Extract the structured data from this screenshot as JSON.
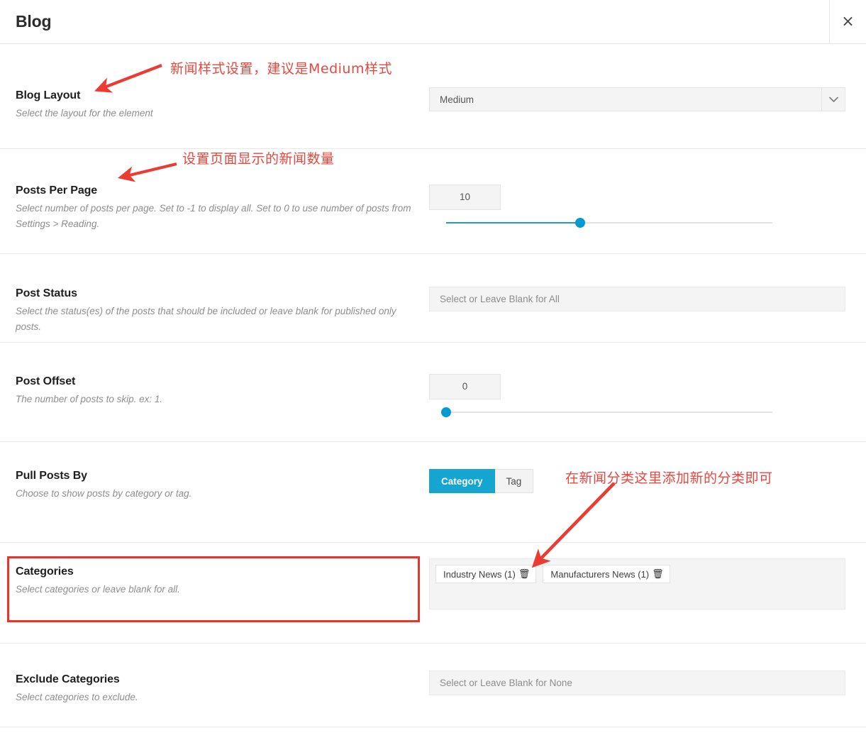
{
  "header": {
    "title": "Blog",
    "close_label": "×",
    "close_icon": "close-icon"
  },
  "rows": {
    "blog_layout": {
      "label": "Blog Layout",
      "desc": "Select the layout for the element",
      "select_value": "Medium",
      "caret_icon": "chevron-down-icon"
    },
    "posts_per_page": {
      "label": "Posts Per Page",
      "desc": "Select number of posts per page. Set to -1 to display all. Set to 0 to use number of posts from Settings > Reading.",
      "value": "10",
      "slider_percent": 41
    },
    "post_status": {
      "label": "Post Status",
      "desc": "Select the status(es) of the posts that should be included or leave blank for published only posts.",
      "placeholder": "Select or Leave Blank for All"
    },
    "post_offset": {
      "label": "Post Offset",
      "desc": "The number of posts to skip. ex: 1.",
      "value": "0",
      "slider_percent": 0
    },
    "pull_posts_by": {
      "label": "Pull Posts By",
      "desc": "Choose to show posts by category or tag.",
      "option_category": "Category",
      "option_tag": "Tag",
      "selected": "Category"
    },
    "categories": {
      "label": "Categories",
      "desc": "Select categories or leave blank for all.",
      "chips": [
        {
          "label": "Industry News (1)",
          "trash_icon": "🗑"
        },
        {
          "label": "Manufacturers News (1)",
          "trash_icon": "🗑"
        }
      ]
    },
    "exclude_categories": {
      "label": "Exclude Categories",
      "desc": "Select categories to exclude.",
      "placeholder": "Select or Leave Blank for None"
    }
  },
  "annotations": {
    "note_layout": "新闻样式设置，建议是Medium样式",
    "note_posts": "设置页面显示的新闻数量",
    "note_categories": "在新闻分类这里添加新的分类即可"
  },
  "colors": {
    "accent": "#15a5d1",
    "slider": "#009cd1",
    "annotation": "#e8473f",
    "highlight_box": "#e8352b"
  }
}
